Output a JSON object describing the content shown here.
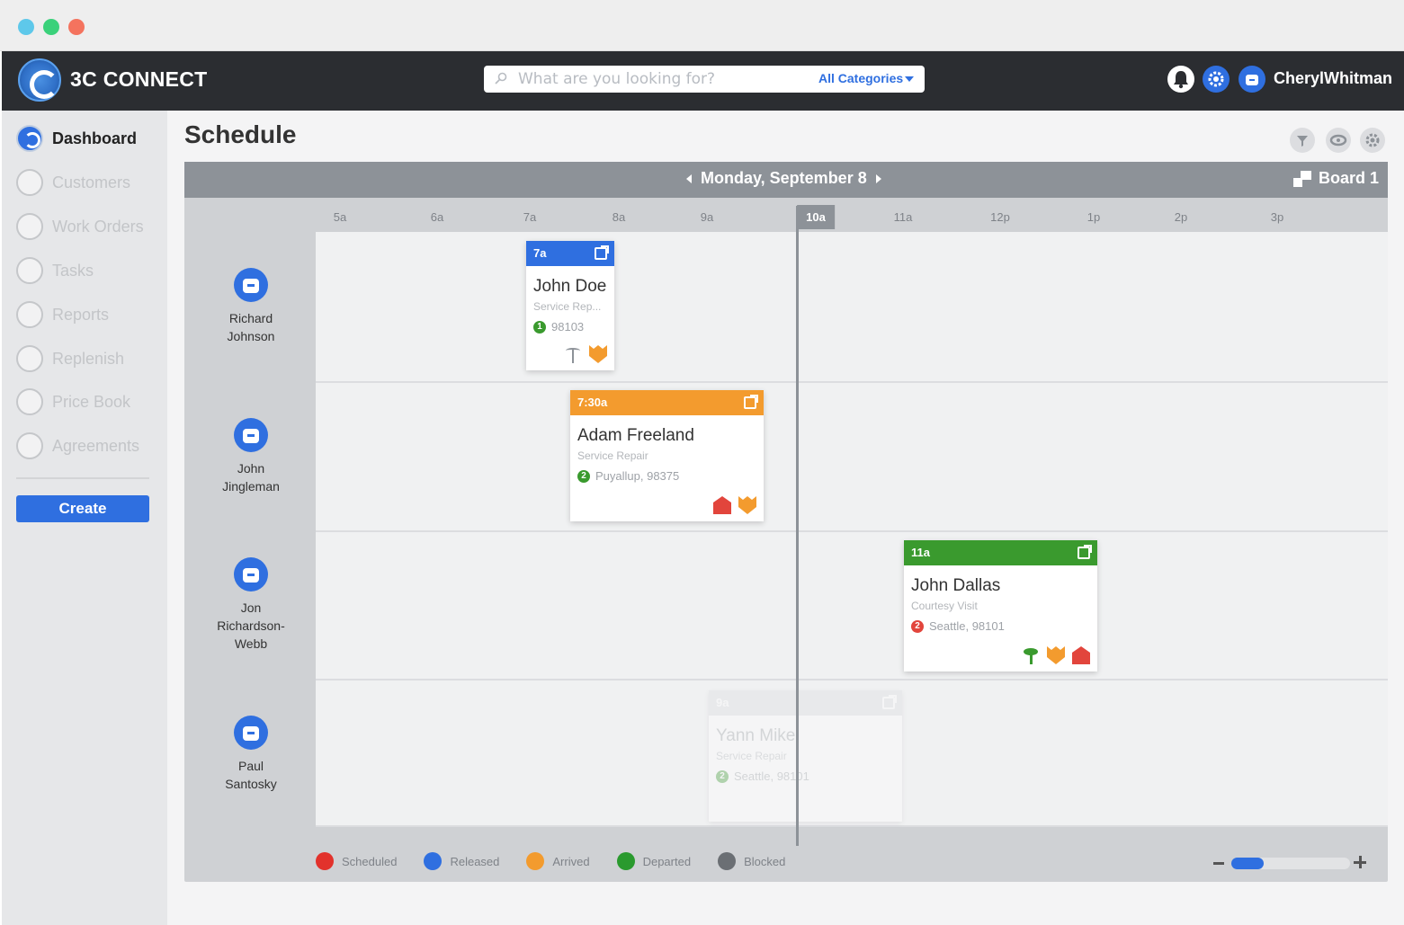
{
  "app": {
    "brand": "3C CONNECT",
    "user_name": "CherylWhitman"
  },
  "search": {
    "placeholder": "What are you looking for?",
    "category": "All Categories"
  },
  "sidebar": {
    "items": [
      {
        "label": "Dashboard",
        "icon": "speedometer-icon",
        "active": true
      },
      {
        "label": "Customers",
        "icon": "user-icon",
        "active": false
      },
      {
        "label": "Work Orders",
        "icon": "list-icon",
        "active": false
      },
      {
        "label": "Tasks",
        "icon": "check-icon",
        "active": false
      },
      {
        "label": "Reports",
        "icon": "megaphone-icon",
        "active": false
      },
      {
        "label": "Replenish",
        "icon": "truck-icon",
        "active": false
      },
      {
        "label": "Price Book",
        "icon": "dollar-icon",
        "active": false
      },
      {
        "label": "Agreements",
        "icon": "document-icon",
        "active": false
      }
    ],
    "create_label": "Create"
  },
  "page": {
    "title": "Schedule"
  },
  "board": {
    "date": "Monday, September 8",
    "board_name": "Board 1",
    "current_time": "10a",
    "times": [
      "5a",
      "6a",
      "7a",
      "8a",
      "9a",
      "10a",
      "11a",
      "12p",
      "1p",
      "2p",
      "3p"
    ],
    "technicians": [
      {
        "name": "Richard\nJohnson"
      },
      {
        "name": "John\nJingleman"
      },
      {
        "name": "Jon\nRichardson-\nWebb"
      },
      {
        "name": "Paul\nSantosky"
      }
    ],
    "jobs": [
      {
        "time": "7a",
        "customer": "John Doe",
        "type": "Service Rep...",
        "location": "98103",
        "badge": "1",
        "status": "Released",
        "color": "#2f6fe0",
        "badge_color": "#3a9a2e",
        "icons": [
          "tool-icon",
          "shield-icon"
        ]
      },
      {
        "time": "7:30a",
        "customer": "Adam Freeland",
        "type": "Service Repair",
        "location": "Puyallup, 98375",
        "badge": "2",
        "status": "Arrived",
        "color": "#f39b2e",
        "badge_color": "#3a9a2e",
        "icons": [
          "house-icon",
          "shield-icon"
        ]
      },
      {
        "time": "11a",
        "customer": "John Dallas",
        "type": "Courtesy Visit",
        "location": "Seattle, 98101",
        "badge": "2",
        "status": "Departed",
        "color": "#3a9a2e",
        "badge_color": "#e2453c",
        "icons": [
          "plant-icon",
          "shield-icon",
          "house-icon"
        ]
      },
      {
        "time": "9a",
        "customer": "Yann Mikel",
        "type": "Service Repair",
        "location": "Seattle, 98101",
        "badge": "2",
        "status": "Blocked",
        "color": "#dcdde0",
        "badge_color": "#3a9a2e",
        "icons": []
      }
    ]
  },
  "legend": [
    {
      "label": "Scheduled",
      "color": "#e2322c"
    },
    {
      "label": "Released",
      "color": "#2f6fe0"
    },
    {
      "label": "Arrived",
      "color": "#f39b2e"
    },
    {
      "label": "Departed",
      "color": "#2a9a2e"
    },
    {
      "label": "Blocked",
      "color": "#6b6f74"
    }
  ],
  "zoom": {
    "level": 0.27
  }
}
